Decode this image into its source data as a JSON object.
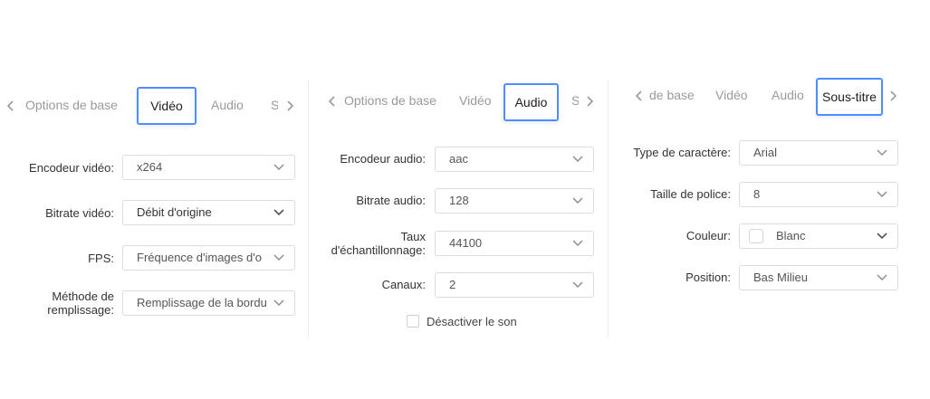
{
  "colors": {
    "accent": "#4f8dff",
    "text": "#333333",
    "muted": "#9a9a9a",
    "border": "#dcdcdc"
  },
  "video_panel": {
    "tabs": [
      "Options de base",
      "Vidéo",
      "Audio",
      "S"
    ],
    "active_tab": "Vidéo",
    "fields": [
      {
        "label": "Encodeur vidéo:",
        "value": "x264"
      },
      {
        "label": "Bitrate vidéo:",
        "value": "Débit d'origine"
      },
      {
        "label": "FPS:",
        "value": "Fréquence d'images d'o"
      },
      {
        "label_line1": "Méthode de",
        "label_line2": "remplissage:",
        "value": "Remplissage de la bordu"
      }
    ]
  },
  "audio_panel": {
    "tabs": [
      "Options de base",
      "Vidéo",
      "Audio",
      "S"
    ],
    "active_tab": "Audio",
    "fields": [
      {
        "label": "Encodeur audio:",
        "value": "aac"
      },
      {
        "label": "Bitrate audio:",
        "value": "128"
      },
      {
        "label_line1": "Taux",
        "label_line2": "d'échantillonnage:",
        "value": "44100"
      },
      {
        "label": "Canaux:",
        "value": "2"
      }
    ],
    "mute_label": "Désactiver le son",
    "mute_checked": false
  },
  "subtitle_panel": {
    "tabs": [
      "de base",
      "Vidéo",
      "Audio",
      "Sous-titre"
    ],
    "active_tab": "Sous-titre",
    "fields": [
      {
        "label": "Type de caractère:",
        "value": "Arial"
      },
      {
        "label": "Taille de police:",
        "value": "8"
      },
      {
        "label": "Couleur:",
        "value": "Blanc",
        "swatch_color": "#ffffff"
      },
      {
        "label": "Position:",
        "value": "Bas Milieu"
      }
    ]
  }
}
